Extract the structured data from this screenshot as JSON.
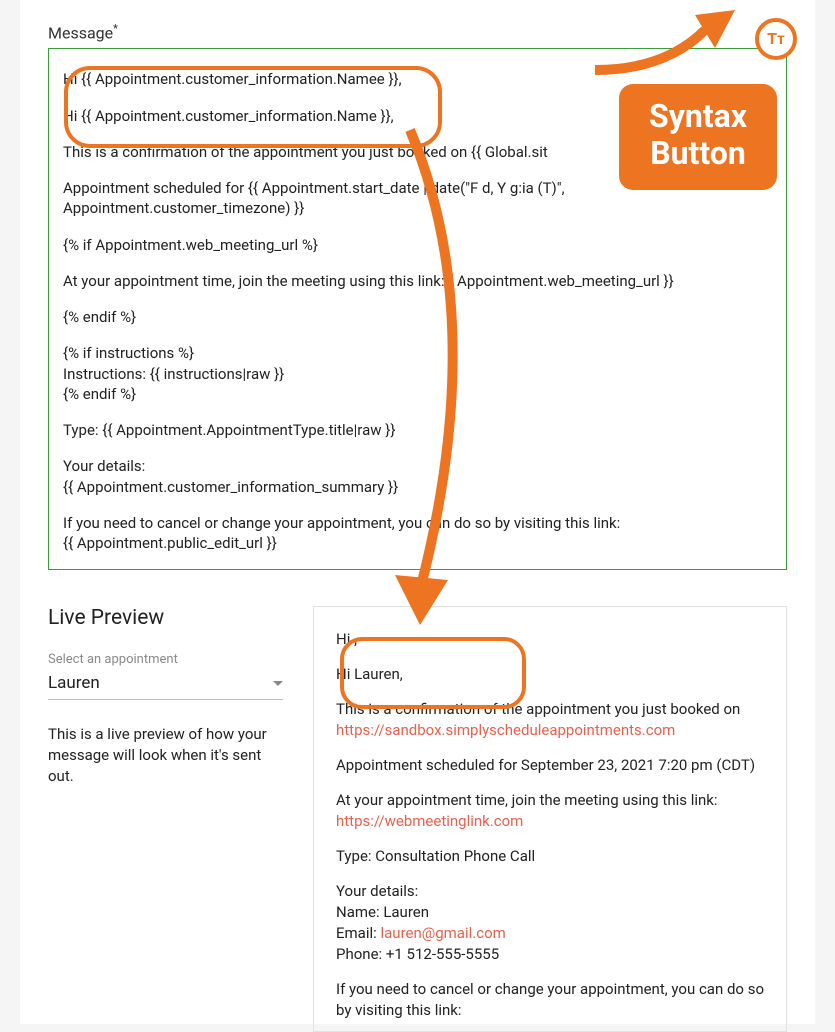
{
  "message": {
    "label": "Message",
    "required_mark": "*",
    "lines": {
      "l0": "Hi {{ Appointment.customer_information.Namee }},",
      "l1": "Hi {{ Appointment.customer_information.Name }},",
      "l2": "This is a confirmation of the appointment you just booked on {{ Global.sit",
      "l3": "Appointment scheduled for {{ Appointment.start_date | date(\"F d, Y g:ia (T)\", Appointment.customer_timezone) }}",
      "l4": " {% if Appointment.web_meeting_url %}",
      "l5": "At your appointment time, join the meeting using this link: {  Appointment.web_meeting_url }}",
      "l6": "{% endif %}",
      "l7": "{% if instructions %}",
      "l8": "Instructions: {{ instructions|raw }}",
      "l9": "{% endif %}",
      "l10": "Type: {{ Appointment.AppointmentType.title|raw }}",
      "l11": "Your details:",
      "l12": "{{ Appointment.customer_information_summary }}",
      "l13": "If you need to cancel or change your appointment, you can do so by visiting this link:",
      "l14": "{{ Appointment.public_edit_url }}"
    }
  },
  "syntax_button": {
    "icon_label": "Tᴛ",
    "callout_line1": "Syntax",
    "callout_line2": "Button"
  },
  "live_preview": {
    "title": "Live Preview",
    "select_label": "Select an appointment",
    "select_value": "Lauren",
    "help_text": "This is a live preview of how your message will look when it's sent out."
  },
  "preview_body": {
    "p0": "Hi ,",
    "p1": "Hi Lauren,",
    "p2a": "This is a confirmation of the appointment you just booked on ",
    "p2b": "https://sandbox.simplyscheduleappointments.com",
    "p3": "Appointment scheduled for September 23, 2021 7:20 pm (CDT)",
    "p4a": "At your appointment time, join the meeting using this link: ",
    "p4b": "https://webmeetinglink.com",
    "p5": "Type: Consultation Phone Call",
    "p6": "Your details:",
    "p7": "Name: Lauren",
    "p8a": "Email: ",
    "p8b": "lauren@gmail.com",
    "p9": "Phone: +1 512-555-5555",
    "p10": "If you need to cancel or change your appointment, you can do so by visiting this link:"
  }
}
